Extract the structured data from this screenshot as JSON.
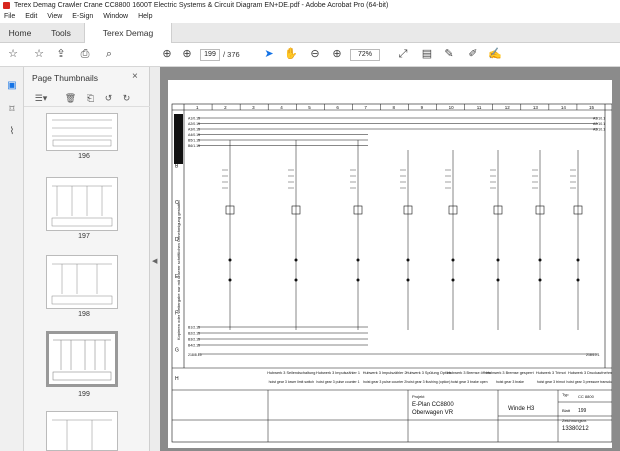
{
  "window": {
    "title": "Terex Demag Crawler Crane CC8800 1600T Electric Systems & Circuit Diagram EN+DE.pdf - Adobe Acrobat Pro (64-bit)"
  },
  "menu": [
    "File",
    "Edit",
    "View",
    "E-Sign",
    "Window",
    "Help"
  ],
  "tabs": [
    {
      "label": "Home"
    },
    {
      "label": "Tools"
    },
    {
      "label": "Terex Demag Crawl...",
      "close": "×"
    }
  ],
  "toolbar": {
    "page_current": "199",
    "page_total": "/ 376",
    "zoom": "72%"
  },
  "panel": {
    "title": "Page Thumbnails",
    "close": "×",
    "thumbnails": [
      {
        "label": "196"
      },
      {
        "label": "197"
      },
      {
        "label": "198"
      },
      {
        "label": "199"
      }
    ]
  },
  "drawing": {
    "brand": "TEREX",
    "side_text": "Kopieren oder Weitergabe nur mit unserer schriftlichen Genehmigung gestattet",
    "columns": [
      "1",
      "2",
      "3",
      "4",
      "5",
      "6",
      "7",
      "8",
      "9",
      "10",
      "11",
      "12",
      "13",
      "14",
      "15"
    ],
    "rows": [
      "A",
      "B",
      "C",
      "D",
      "E",
      "F",
      "G",
      "H"
    ],
    "bus_lines": [
      "A1/0.15",
      "A2/0.15",
      "A3/0.15",
      "A4/0.15",
      "B5/1.15",
      "B6/1.15"
    ],
    "bus_lines_right": [
      "A1/10.1",
      "A2/10.1",
      "A3/10.1"
    ],
    "bottom_lines": [
      "B1/2.15",
      "B2/2.15",
      "B3/2.15",
      "B4/2.15"
    ],
    "gnd_left": "218/8.15",
    "gnd_right": "218/10.1",
    "descriptions_de": [
      "Hubwerk 3 Seilendschaltung",
      "Hubwerk 3 Impulszähler 1",
      "Hubwerk 3 Impulszähler 2",
      "Hubwerk 3 Spülung Option",
      "Hubwerk 3 Bremse öffnen",
      "Hubwerk 3 Bremse gesperrt",
      "Hubwerk 3 Trimot",
      "Hubwerk 3 Druckaufnehmer"
    ],
    "descriptions_en": [
      "hoist gear 3 lower limit switch",
      "hoist gear 3 pulse counter 1",
      "hoist gear 3 pulse counter 2",
      "hoist gear 3 flushing (option)",
      "hoist gear 3 brake open",
      "hoist gear 3 brake",
      "hoist gear 3 trimot",
      "hoist gear 3 pressure transducer"
    ],
    "tb_project_label": "Projekt",
    "tb_project": "E-Plan CC8800",
    "tb_sub": "Oberwagen VR",
    "tb_section": "Winde H3",
    "tb_drawing_no_label": "Zeichnungsnr.",
    "tb_drawing_no": "13380212",
    "tb_type_label": "Typ",
    "tb_type": "CC 8800",
    "tb_sheet": "199",
    "tb_sheet_label": "Blatt"
  }
}
